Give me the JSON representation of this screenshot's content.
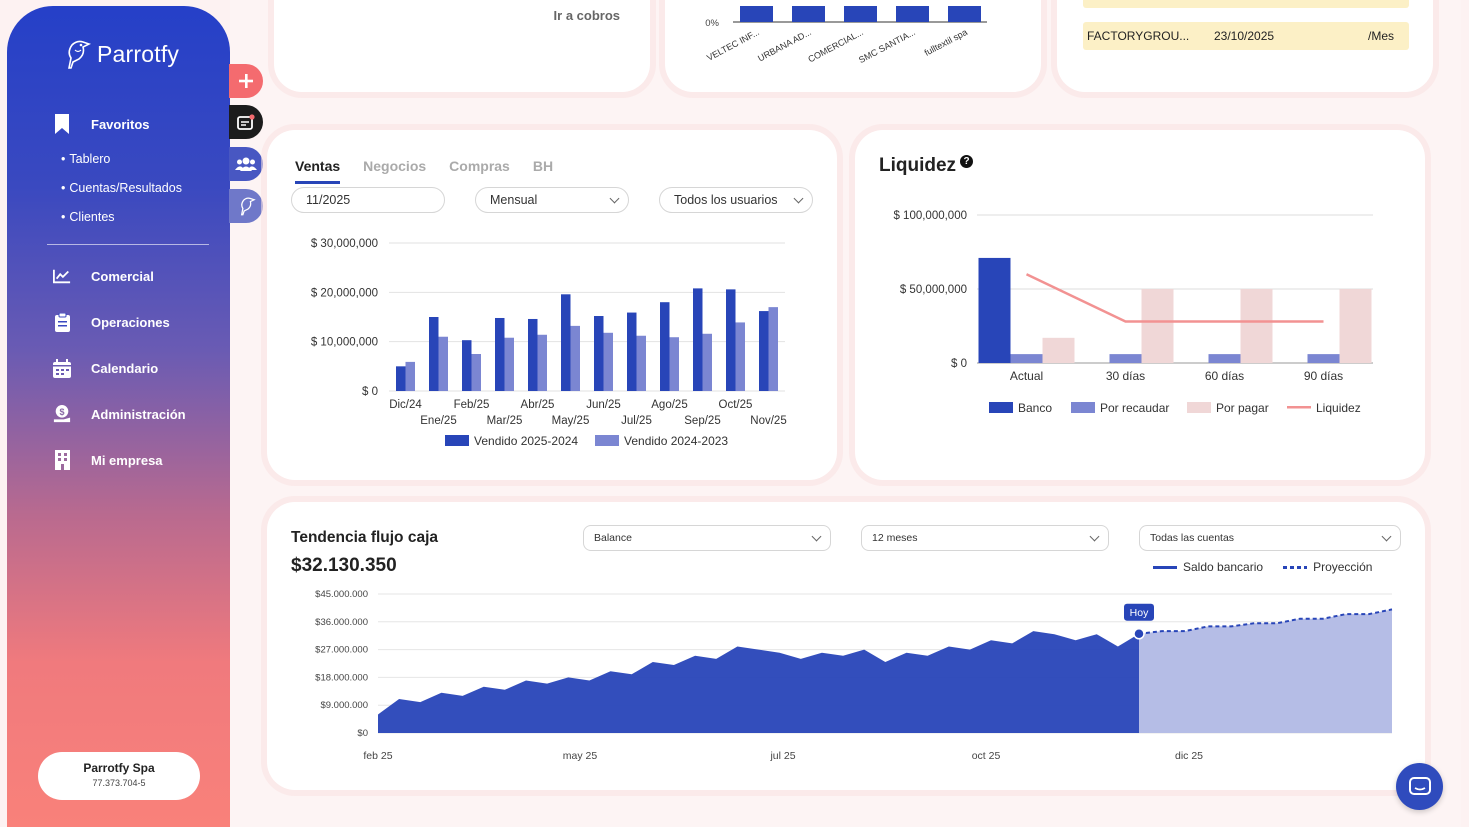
{
  "app": {
    "name": "Parrotfy"
  },
  "colors": {
    "primary": "#2845b8",
    "secondary": "#7b86d2",
    "accent": "#f46b6f",
    "pink_bar": "#f0d7d7",
    "line_red": "#f29292",
    "projection_fill": "#b5bde6"
  },
  "sidebar": {
    "favoritos": "Favoritos",
    "sub_items": [
      "Tablero",
      "Cuentas/Resultados",
      "Clientes"
    ],
    "items": [
      {
        "label": "Comercial",
        "icon": "chart-line-icon"
      },
      {
        "label": "Operaciones",
        "icon": "clipboard-icon"
      },
      {
        "label": "Calendario",
        "icon": "calendar-icon"
      },
      {
        "label": "Administración",
        "icon": "money-hand-icon"
      },
      {
        "label": "Mi empresa",
        "icon": "building-icon"
      }
    ],
    "company": {
      "name": "Parrotfy Spa",
      "rut": "77.373.704-5"
    }
  },
  "top": {
    "cobros_link": "Ir a cobros",
    "mini_chart": {
      "y_label": "0%",
      "categories": [
        "VELTEC INF...",
        "URBANA AD...",
        "COMERCIAL...",
        "SMC SANTIA...",
        "fulltextil spa"
      ]
    },
    "factura": {
      "name": "FACTORYGROU...",
      "date": "23/10/2025",
      "period": "/Mes"
    }
  },
  "ventas": {
    "tabs": [
      "Ventas",
      "Negocios",
      "Compras",
      "BH"
    ],
    "active_tab": "Ventas",
    "period_value": "11/2025",
    "mode_value": "Mensual",
    "users_value": "Todos los usuarios",
    "chart_data": {
      "type": "bar",
      "categories": [
        "Dic/24",
        "Ene/25",
        "Feb/25",
        "Mar/25",
        "Abr/25",
        "May/25",
        "Jun/25",
        "Jul/25",
        "Ago/25",
        "Sep/25",
        "Oct/25",
        "Nov/25"
      ],
      "series": [
        {
          "name": "Vendido 2025-2024",
          "values": [
            5000000,
            15000000,
            10300000,
            14800000,
            14600000,
            19600000,
            15200000,
            15900000,
            18000000,
            20800000,
            20600000,
            16200000
          ]
        },
        {
          "name": "Vendido 2024-2023",
          "values": [
            5900000,
            11000000,
            7500000,
            10800000,
            11400000,
            13200000,
            11800000,
            11200000,
            10900000,
            11600000,
            13900000,
            17000000
          ]
        }
      ],
      "y_ticks": [
        "$ 0",
        "$ 10,000,000",
        "$ 20,000,000",
        "$ 30,000,000"
      ],
      "ylim": [
        0,
        30000000
      ],
      "legend_position": "bottom"
    }
  },
  "liquidez": {
    "title": "Liquidez",
    "chart_data": {
      "type": "bar",
      "categories": [
        "Actual",
        "30 días",
        "60 días",
        "90 días"
      ],
      "series": [
        {
          "name": "Banco",
          "values": [
            71000000,
            0,
            0,
            0
          ]
        },
        {
          "name": "Por recaudar",
          "values": [
            6000000,
            6000000,
            6000000,
            6000000
          ]
        },
        {
          "name": "Por pagar",
          "values": [
            17000000,
            50000000,
            50000000,
            50000000
          ]
        },
        {
          "name": "Liquidez",
          "values": [
            60000000,
            28000000,
            28000000,
            28000000
          ]
        }
      ],
      "y_ticks": [
        "$ 0",
        "$ 50,000,000",
        "$ 100,000,000"
      ],
      "ylim": [
        0,
        100000000
      ],
      "legend_position": "bottom"
    }
  },
  "flujo": {
    "title": "Tendencia flujo caja",
    "amount": "$32.130.350",
    "balance_value": "Balance",
    "range_value": "12 meses",
    "accounts_value": "Todas las cuentas",
    "legend_saldo": "Saldo bancario",
    "legend_proyeccion": "Proyección",
    "hoy_label": "Hoy",
    "chart_data": {
      "type": "area",
      "x_ticks": [
        "feb 25",
        "may 25",
        "jul 25",
        "oct 25",
        "dic 25"
      ],
      "y_ticks": [
        "$0",
        "$9.000.000",
        "$18.000.000",
        "$27.000.000",
        "$36.000.000",
        "$45.000.000"
      ],
      "ylim": [
        0,
        45000000
      ],
      "series": [
        {
          "name": "Saldo bancario",
          "values": [
            6000000,
            11000000,
            10000000,
            13000000,
            12000000,
            15000000,
            14000000,
            17000000,
            16000000,
            18000000,
            17000000,
            20000000,
            19000000,
            23000000,
            22000000,
            25000000,
            24000000,
            28000000,
            27000000,
            26000000,
            24000000,
            26000000,
            25000000,
            27000000,
            23000000,
            26000000,
            25000000,
            28000000,
            27000000,
            30000000,
            29000000,
            33000000,
            32000000,
            30000000,
            32000000,
            28000000,
            32130350
          ]
        },
        {
          "name": "Proyección",
          "values": [
            32130350,
            33000000,
            33000000,
            34500000,
            34500000,
            35500000,
            35500000,
            37000000,
            37000000,
            38500000,
            38500000,
            40000000
          ]
        }
      ]
    }
  }
}
